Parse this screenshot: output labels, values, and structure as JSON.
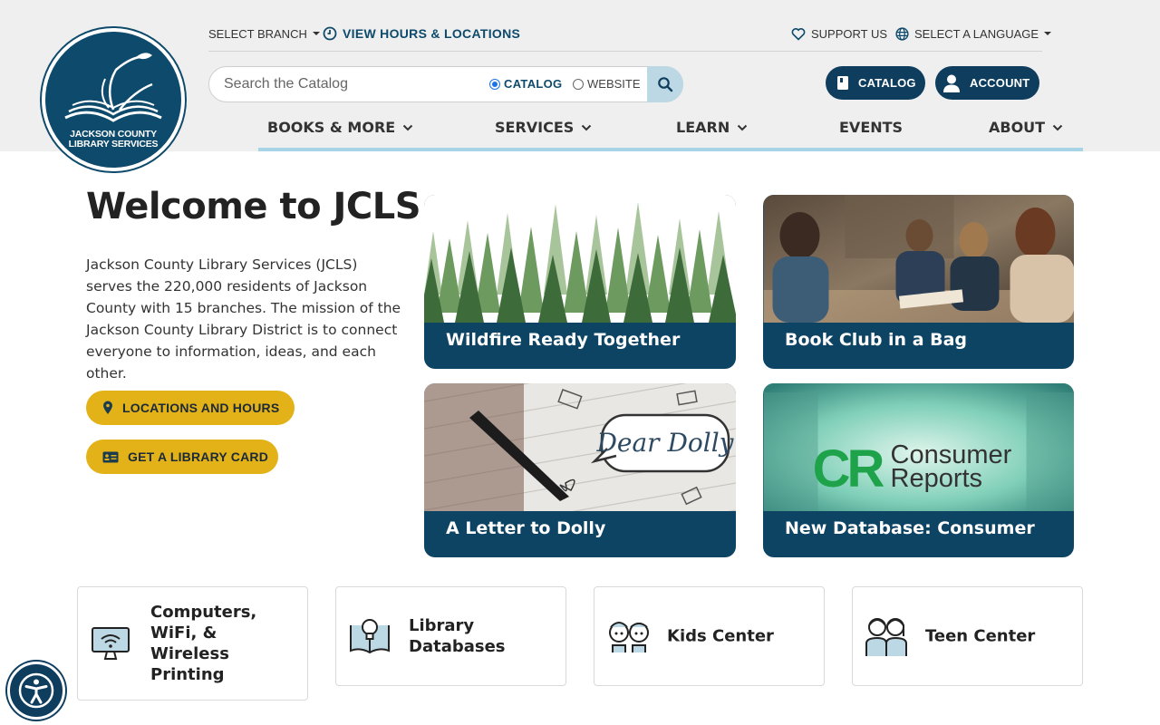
{
  "logo": {
    "line1": "JACKSON COUNTY",
    "line2": "LIBRARY SERVICES"
  },
  "utility": {
    "select_branch": "SELECT BRANCH",
    "view_hours": "VIEW HOURS & LOCATIONS",
    "support_us": "SUPPORT US",
    "select_language": "SELECT A LANGUAGE"
  },
  "search": {
    "placeholder": "Search the Catalog",
    "option_catalog": "CATALOG",
    "option_website": "WEBSITE",
    "selected": "CATALOG"
  },
  "header_buttons": {
    "catalog": "CATALOG",
    "account": "ACCOUNT"
  },
  "nav": [
    {
      "label": "BOOKS & MORE"
    },
    {
      "label": "SERVICES"
    },
    {
      "label": "LEARN"
    },
    {
      "label": "EVENTS"
    },
    {
      "label": "ABOUT"
    }
  ],
  "welcome": {
    "title": "Welcome to JCLS",
    "description": "Jackson County Library Services (JCLS) serves the 220,000 residents of Jackson County with 15 branches. The mission of the Jackson County Library District is to connect everyone to information, ideas, and each other.",
    "btn_locations": "LOCATIONS AND HOURS",
    "btn_card": "GET A LIBRARY CARD"
  },
  "cards": [
    {
      "title": "Wildfire Ready Together"
    },
    {
      "title": "Book Club in a Bag"
    },
    {
      "title": "A Letter to Dolly",
      "image_text": "Dear Dolly"
    },
    {
      "title": "New Database: Consumer",
      "image_text_logo": "CR",
      "image_text_1": "Consumer",
      "image_text_2": "Reports"
    }
  ],
  "tiles": [
    {
      "title": "Computers, WiFi, & Wireless Printing"
    },
    {
      "title": "Library Databases"
    },
    {
      "title": "Kids Center"
    },
    {
      "title": "Teen Center"
    }
  ],
  "colors": {
    "navy": "#0e3d5e",
    "yellow": "#e3b219",
    "nav_underline": "#a7d4e6",
    "header_bg": "#efefef"
  }
}
